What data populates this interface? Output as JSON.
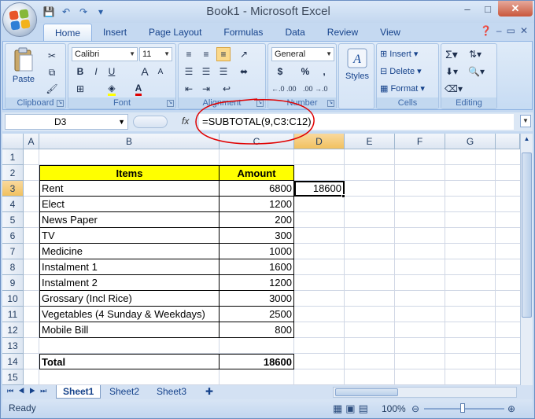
{
  "window": {
    "title": "Book1 - Microsoft Excel",
    "controls": [
      "–",
      "□",
      "✕"
    ]
  },
  "qat": [
    "💾",
    "↶",
    "↷",
    "▾"
  ],
  "tabs": [
    "Home",
    "Insert",
    "Page Layout",
    "Formulas",
    "Data",
    "Review",
    "View"
  ],
  "ribbon": {
    "clipboard": {
      "label": "Clipboard",
      "paste": "Paste"
    },
    "font": {
      "label": "Font",
      "name": "Calibri",
      "size": "11",
      "bold": "B",
      "italic": "I",
      "underline": "U",
      "grow": "A",
      "shrink": "A"
    },
    "alignment": {
      "label": "Alignment"
    },
    "number": {
      "label": "Number",
      "format": "General",
      "currency": "$",
      "percent": "%",
      "comma": ",",
      "inc": "←.0 .00",
      "dec": ".00 →.0"
    },
    "styles": {
      "label": "Styles"
    },
    "cells": {
      "label": "Cells",
      "insert": "Insert",
      "delete": "Delete",
      "format": "Format"
    },
    "editing": {
      "label": "Editing"
    }
  },
  "formula_bar": {
    "name_box": "D3",
    "fx": "fx",
    "formula": "=SUBTOTAL(9,C3:C12)"
  },
  "columns": [
    "A",
    "B",
    "C",
    "D",
    "E",
    "F",
    "G"
  ],
  "rows": [
    "1",
    "2",
    "3",
    "4",
    "5",
    "6",
    "7",
    "8",
    "9",
    "10",
    "11",
    "12",
    "13",
    "14",
    "15"
  ],
  "table": {
    "header_items": "Items",
    "header_amount": "Amount",
    "items": [
      {
        "name": "Rent",
        "amount": "6800"
      },
      {
        "name": "Elect",
        "amount": "1200"
      },
      {
        "name": "News Paper",
        "amount": "200"
      },
      {
        "name": "TV",
        "amount": "300"
      },
      {
        "name": "Medicine",
        "amount": "1000"
      },
      {
        "name": "Instalment 1",
        "amount": "1600"
      },
      {
        "name": "Instalment 2",
        "amount": "1200"
      },
      {
        "name": "Grossary (Incl Rice)",
        "amount": "3000"
      },
      {
        "name": "Vegetables (4 Sunday & Weekdays)",
        "amount": "2500"
      },
      {
        "name": "Mobile Bill",
        "amount": "800"
      }
    ],
    "total_label": "Total",
    "total_value": "18600"
  },
  "active_cell": {
    "ref": "D3",
    "value": "18600"
  },
  "sheets": [
    "Sheet1",
    "Sheet2",
    "Sheet3"
  ],
  "status": {
    "ready": "Ready",
    "zoom": "100%"
  },
  "colors": {
    "header_fill": "#ffff00",
    "annotation": "#e00000",
    "accent": "#15428b"
  }
}
